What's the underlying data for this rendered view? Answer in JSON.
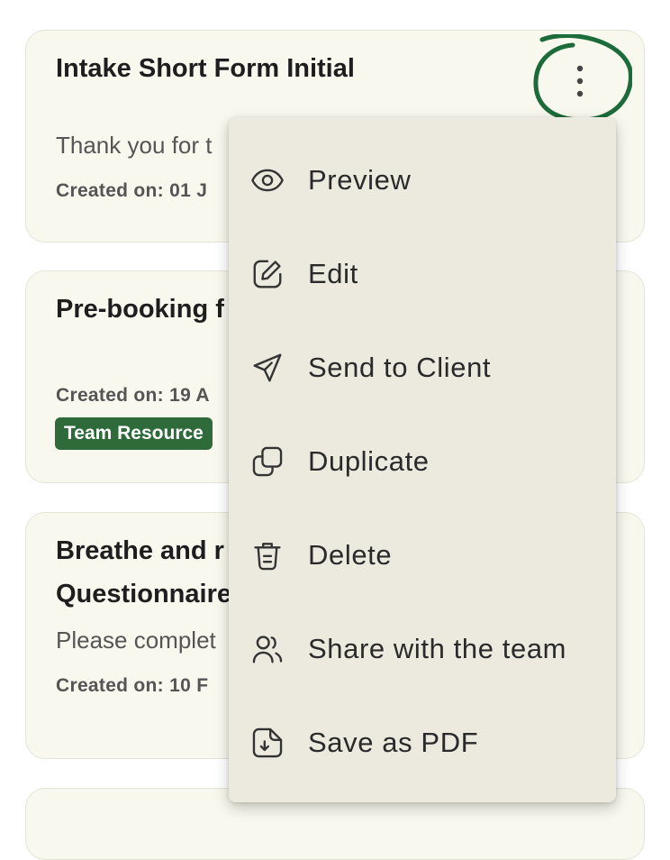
{
  "cards": [
    {
      "title": "Intake Short Form Initial",
      "description": "Thank you for t",
      "created": "Created on: 01 J"
    },
    {
      "title": "Pre-booking f",
      "created": "Created on: 19 A",
      "tag": "Team Resource"
    },
    {
      "title_line1": "Breathe and r",
      "title_line2": "Questionnaire",
      "description": "Please complet",
      "created": "Created on: 10 F"
    }
  ],
  "menu": {
    "items": [
      {
        "label": "Preview",
        "icon": "eye-icon"
      },
      {
        "label": "Edit",
        "icon": "pencil-square-icon"
      },
      {
        "label": "Send to Client",
        "icon": "paper-plane-icon"
      },
      {
        "label": "Duplicate",
        "icon": "duplicate-icon"
      },
      {
        "label": "Delete",
        "icon": "trash-icon"
      },
      {
        "label": "Share with the team",
        "icon": "users-icon"
      },
      {
        "label": "Save as PDF",
        "icon": "file-download-icon"
      }
    ]
  },
  "colors": {
    "card_bg": "#f8f8ee",
    "menu_bg": "#eceadf",
    "tag_bg": "#2e6a3a",
    "annotation_circle": "#1c6b3a"
  }
}
